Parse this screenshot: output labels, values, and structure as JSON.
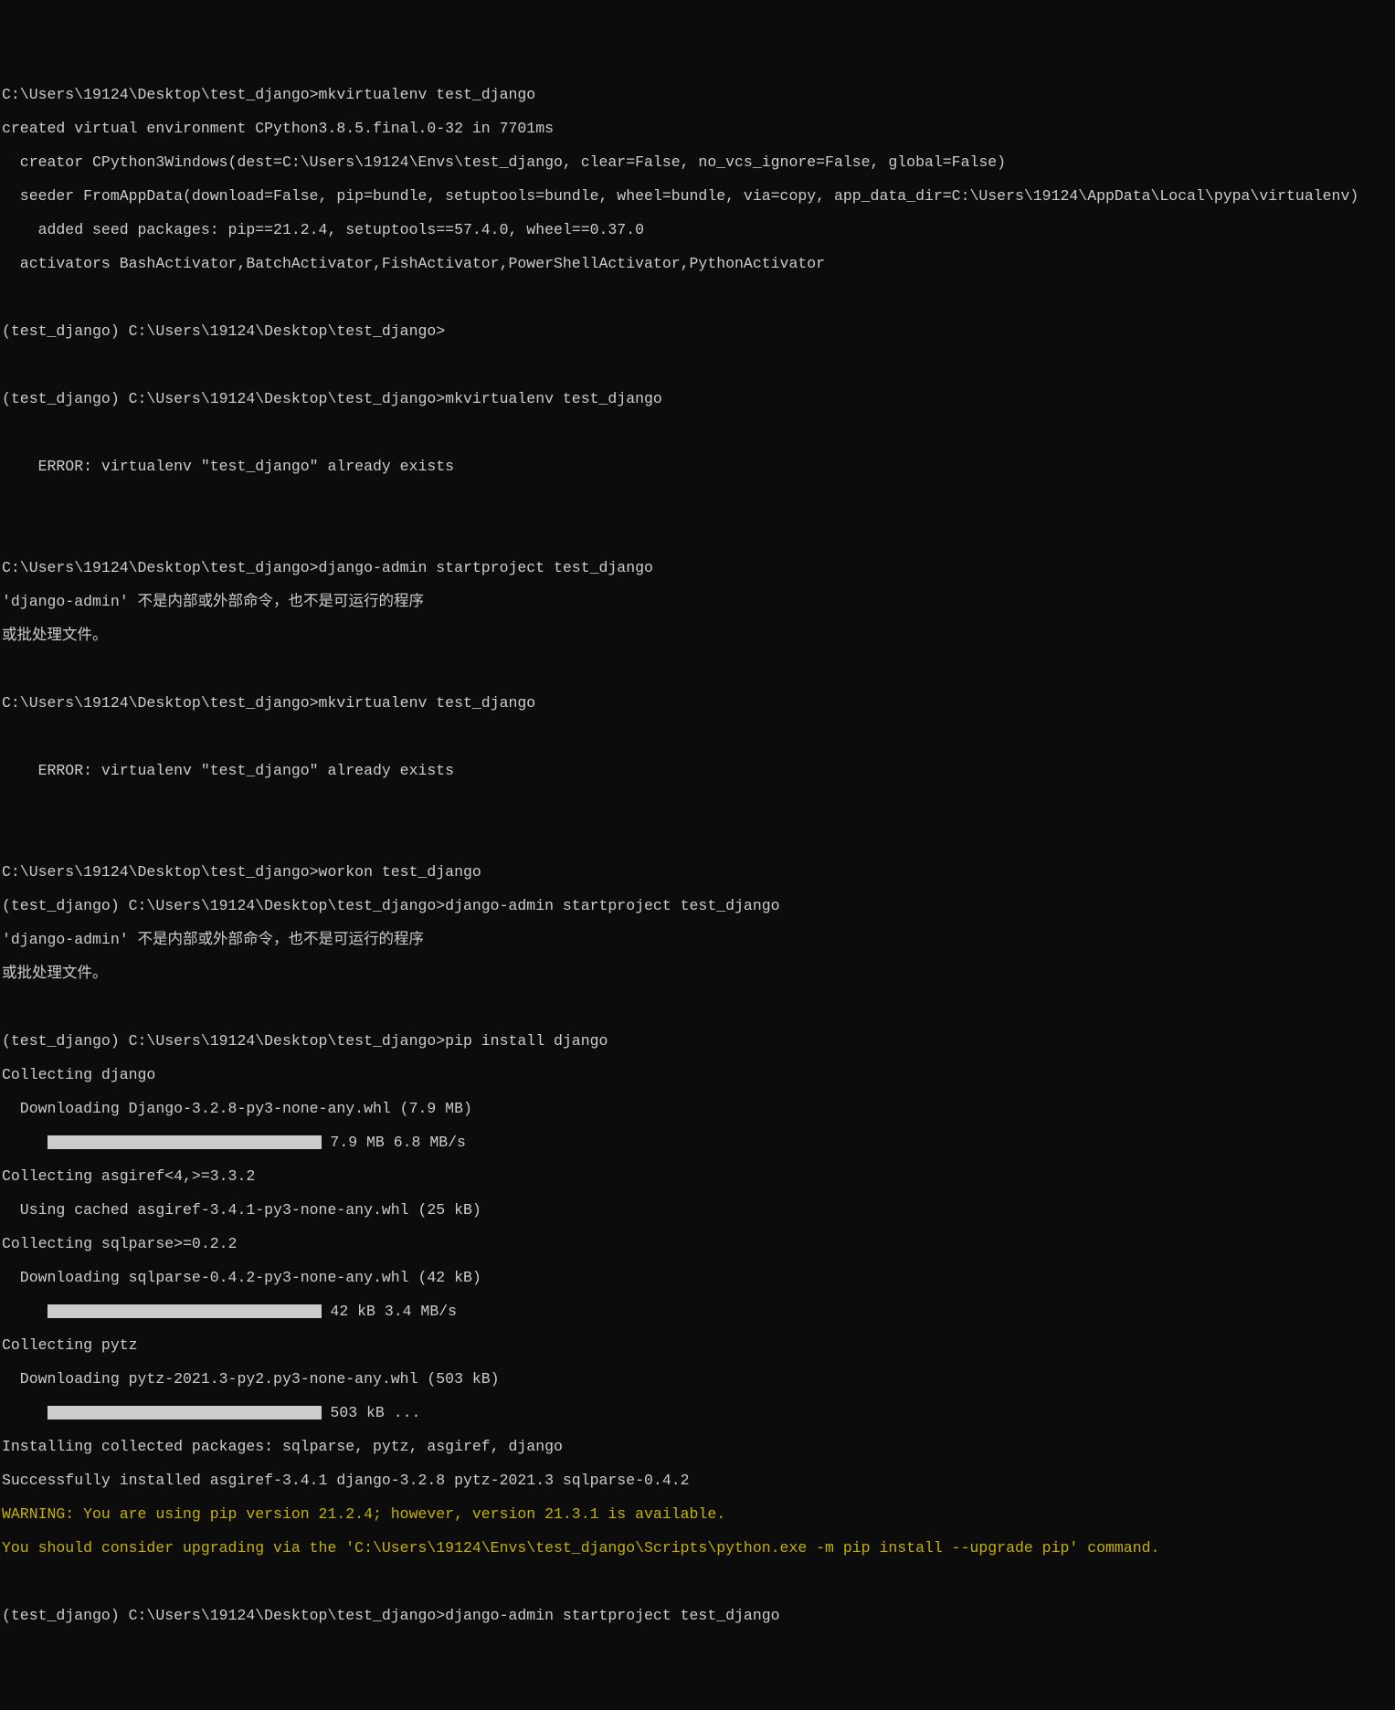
{
  "lines": {
    "l1": "C:\\Users\\19124\\Desktop\\test_django>mkvirtualenv test_django",
    "l2": "created virtual environment CPython3.8.5.final.0-32 in 7701ms",
    "l3": "  creator CPython3Windows(dest=C:\\Users\\19124\\Envs\\test_django, clear=False, no_vcs_ignore=False, global=False)",
    "l4": "  seeder FromAppData(download=False, pip=bundle, setuptools=bundle, wheel=bundle, via=copy, app_data_dir=C:\\Users\\19124\\AppData\\Local\\pypa\\virtualenv)",
    "l5": "    added seed packages: pip==21.2.4, setuptools==57.4.0, wheel==0.37.0",
    "l6": "  activators BashActivator,BatchActivator,FishActivator,PowerShellActivator,PythonActivator",
    "l7": "",
    "l8": "(test_django) C:\\Users\\19124\\Desktop\\test_django>",
    "l9": "",
    "l10": "(test_django) C:\\Users\\19124\\Desktop\\test_django>mkvirtualenv test_django",
    "l11": "",
    "l12": "    ERROR: virtualenv \"test_django\" already exists",
    "l13": "",
    "l14": "",
    "l15": "C:\\Users\\19124\\Desktop\\test_django>django-admin startproject test_django",
    "l16": "'django-admin' 不是内部或外部命令，也不是可运行的程序",
    "l17": "或批处理文件。",
    "l18": "",
    "l19": "C:\\Users\\19124\\Desktop\\test_django>mkvirtualenv test_django",
    "l20": "",
    "l21": "    ERROR: virtualenv \"test_django\" already exists",
    "l22": "",
    "l23": "",
    "l24": "C:\\Users\\19124\\Desktop\\test_django>workon test_django",
    "l25": "(test_django) C:\\Users\\19124\\Desktop\\test_django>django-admin startproject test_django",
    "l26": "'django-admin' 不是内部或外部命令，也不是可运行的程序",
    "l27": "或批处理文件。",
    "l28": "",
    "l29": "(test_django) C:\\Users\\19124\\Desktop\\test_django>pip install django",
    "l30": "Collecting django",
    "l31": "  Downloading Django-3.2.8-py3-none-any.whl (7.9 MB)",
    "l32_prefix": "     ",
    "l32_suffix": " 7.9 MB 6.8 MB/s",
    "l33": "Collecting asgiref<4,>=3.3.2",
    "l34": "  Using cached asgiref-3.4.1-py3-none-any.whl (25 kB)",
    "l35": "Collecting sqlparse>=0.2.2",
    "l36": "  Downloading sqlparse-0.4.2-py3-none-any.whl (42 kB)",
    "l37_prefix": "     ",
    "l37_suffix": " 42 kB 3.4 MB/s",
    "l38": "Collecting pytz",
    "l39": "  Downloading pytz-2021.3-py2.py3-none-any.whl (503 kB)",
    "l40_prefix": "     ",
    "l40_suffix": " 503 kB ...",
    "l41": "Installing collected packages: sqlparse, pytz, asgiref, django",
    "l42": "Successfully installed asgiref-3.4.1 django-3.2.8 pytz-2021.3 sqlparse-0.4.2",
    "l43": "WARNING: You are using pip version 21.2.4; however, version 21.3.1 is available.",
    "l44": "You should consider upgrading via the 'C:\\Users\\19124\\Envs\\test_django\\Scripts\\python.exe -m pip install --upgrade pip' command.",
    "l45": "",
    "l46": "(test_django) C:\\Users\\19124\\Desktop\\test_django>django-admin startproject test_django"
  }
}
